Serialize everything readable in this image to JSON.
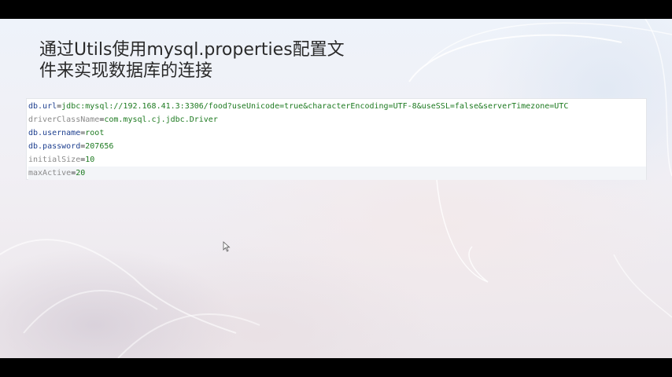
{
  "slide": {
    "title_line1": "通过Utils使用mysql.properties配置文",
    "title_line2": "件来实现数据库的连接"
  },
  "properties": [
    {
      "key": "db.url",
      "value": "jdbc:mysql://192.168.41.3:3306/food?useUnicode=true&characterEncoding=UTF-8&useSSL=false&serverTimezone=UTC",
      "key_style": "active"
    },
    {
      "key": "driverClassName",
      "value": "com.mysql.cj.jdbc.Driver",
      "key_style": "inactive"
    },
    {
      "key": "db.username",
      "value": "root",
      "key_style": "active"
    },
    {
      "key": "db.password",
      "value": "207656",
      "key_style": "active"
    },
    {
      "key": "initialSize",
      "value": "10",
      "key_style": "inactive"
    },
    {
      "key": "maxActive",
      "value": "20",
      "key_style": "inactive"
    }
  ],
  "separator": "=",
  "colors": {
    "key_active": "#1d3f8f",
    "key_inactive": "#8a8a8a",
    "value": "#1d7a20",
    "title": "#2a2a2a"
  },
  "icons": {
    "cursor": "mouse-pointer-icon"
  }
}
